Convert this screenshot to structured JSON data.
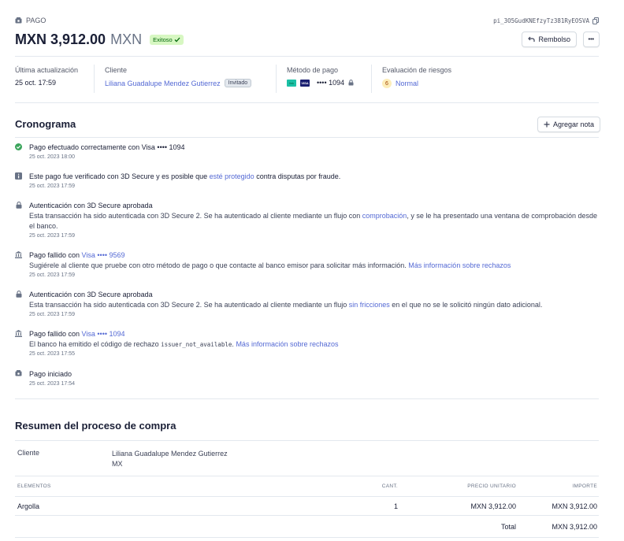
{
  "header": {
    "section_label": "PAGO",
    "payment_id": "pi_3O5GudKNEfzyTz381RyEOSVA",
    "amount": "MXN 3,912.00",
    "currency": "MXN",
    "status_badge": "Exitoso",
    "refund_button": "Rembolso",
    "more_button": "•••"
  },
  "meta": {
    "last_update": {
      "label": "Última actualización",
      "value": "25 oct. 17:59"
    },
    "customer": {
      "label": "Cliente",
      "value": "Liliana Guadalupe Mendez Gutierrez",
      "tag": "Invitado"
    },
    "payment_method": {
      "label": "Método de pago",
      "card_brand_1": "link",
      "card_brand_2": "VISA",
      "last4": "•••• 1094"
    },
    "risk": {
      "label": "Evaluación de riesgos",
      "score": "6",
      "value": "Normal"
    }
  },
  "timeline": {
    "title": "Cronograma",
    "add_note_button": "Agregar nota",
    "items": [
      {
        "icon": "check-circle-icon",
        "title": "Pago efectuado correctamente con Visa •••• 1094",
        "time": "25 oct. 2023 18:00"
      },
      {
        "icon": "info-icon",
        "title_a": "Este pago fue verificado con 3D Secure y es posible que ",
        "title_link": "esté protegido",
        "title_b": " contra disputas por fraude.",
        "time": "25 oct. 2023 17:59"
      },
      {
        "icon": "lock-icon",
        "title": "Autenticación con 3D Secure aprobada",
        "desc_a": "Esta transacción ha sido autenticada con 3D Secure 2. Se ha autenticado al cliente mediante un flujo con ",
        "desc_link": "comprobación",
        "desc_b": ", y se le ha presentado una ventana de comprobación desde el banco.",
        "time": "25 oct. 2023 17:59"
      },
      {
        "icon": "bank-icon",
        "title_a": "Pago fallido con ",
        "title_link": "Visa •••• 9569",
        "desc_a": "Sugiérele al cliente que pruebe con otro método de pago o que contacte al banco emisor para solicitar más información. ",
        "desc_link": "Más información sobre rechazos",
        "time": "25 oct. 2023 17:59"
      },
      {
        "icon": "lock-icon",
        "title": "Autenticación con 3D Secure aprobada",
        "desc_a": "Esta transacción ha sido autenticada con 3D Secure 2. Se ha autenticado al cliente mediante un flujo ",
        "desc_link": "sin fricciones",
        "desc_b": " en el que no se le solicitó ningún dato adicional.",
        "time": "25 oct. 2023 17:59"
      },
      {
        "icon": "bank-icon",
        "title_a": "Pago fallido con ",
        "title_link": "Visa •••• 1094",
        "desc_a": "El banco ha emitido el código de rechazo ",
        "desc_code": "issuer_not_available",
        "desc_b": ". ",
        "desc_link": "Más información sobre rechazos",
        "time": "25 oct. 2023 17:55"
      },
      {
        "icon": "payment-icon",
        "title": "Pago iniciado",
        "time": "25 oct. 2023 17:54"
      }
    ]
  },
  "summary": {
    "title": "Resumen del proceso de compra",
    "customer_label": "Cliente",
    "customer_name": "Liliana Guadalupe Mendez Gutierrez",
    "customer_country": "MX",
    "columns": [
      "ELEMENTOS",
      "CANT.",
      "PRECIO UNITARIO",
      "IMPORTE"
    ],
    "rows": [
      {
        "item": "Argolla",
        "qty": "1",
        "unit_price": "MXN 3,912.00",
        "amount": "MXN 3,912.00"
      }
    ],
    "total_label": "Total",
    "total_value": "MXN 3,912.00"
  }
}
